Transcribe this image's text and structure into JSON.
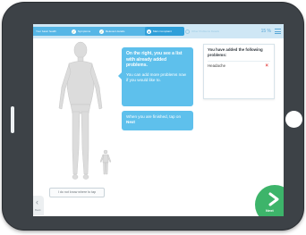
{
  "steps": [
    {
      "label": "Your basic health",
      "state": "done"
    },
    {
      "label": "Symptoms",
      "state": "done"
    },
    {
      "label": "Relevant details",
      "state": "done"
    },
    {
      "label": "Main Complaint",
      "state": "current"
    },
    {
      "label": "Other Problems Details",
      "state": "todo"
    }
  ],
  "progress_percent": "15 %",
  "bubble": {
    "title": "On the right, you see a list with already added problems.",
    "text": "You can add more problems now if you would like to."
  },
  "bubble2": {
    "text_before": "When you are finished, tap on ",
    "next_word": "Next"
  },
  "panel": {
    "title": "You have added the following problems:",
    "problems": [
      {
        "name": "Headache"
      }
    ]
  },
  "buttons": {
    "dont_know": "I do not know where to tap",
    "back_label": "Back",
    "next_label": "Next"
  },
  "colors": {
    "accent": "#5ec0ec",
    "next": "#3db46a",
    "remove": "#e44848"
  }
}
